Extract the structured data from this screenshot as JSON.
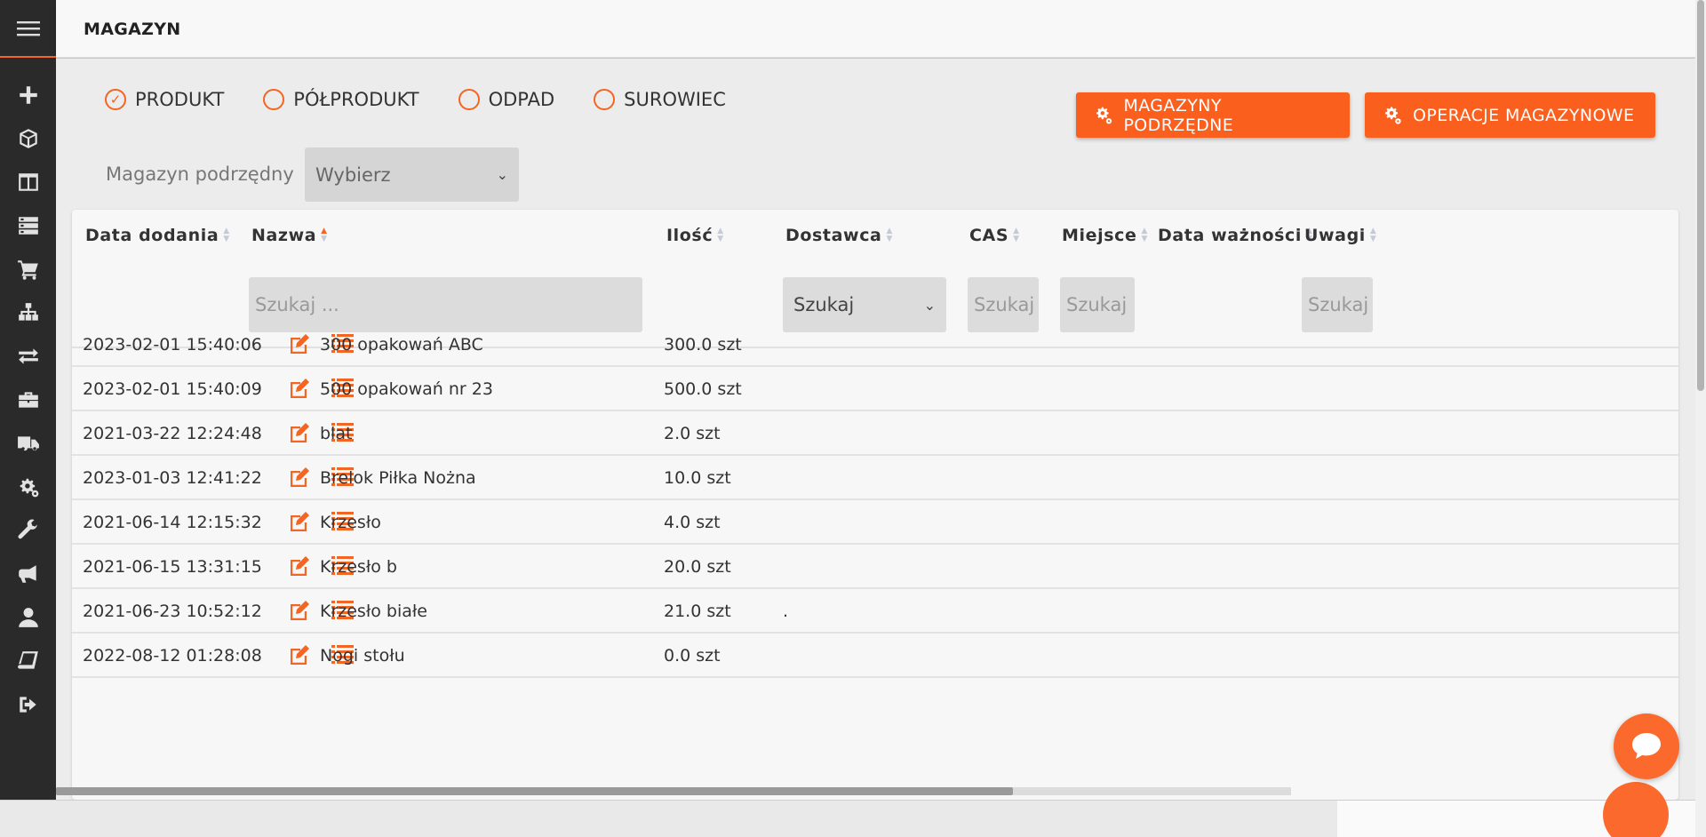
{
  "header": {
    "title": "MAGAZYN"
  },
  "filters": {
    "radios": [
      {
        "label": "PRODUKT",
        "checked": true
      },
      {
        "label": "PÓŁPRODUKT",
        "checked": false
      },
      {
        "label": "ODPAD",
        "checked": false
      },
      {
        "label": "SUROWIEC",
        "checked": false
      }
    ],
    "sub_label": "Magazyn podrzędny",
    "sub_select_value": "Wybierz"
  },
  "actions": {
    "sub_warehouses": "MAGAZYNY PODRZĘDNE",
    "operations": "OPERACJE MAGAZYNOWE"
  },
  "table": {
    "columns": [
      "Data dodania",
      "Nazwa",
      "Ilość",
      "Dostawca",
      "CAS",
      "Miejsce",
      "Data ważności",
      "Uwagi"
    ],
    "filters": {
      "name_placeholder": "Szukaj ...",
      "supplier_value": "Szukaj",
      "cas_placeholder": "Szukaj ..",
      "place_placeholder": "Szukaj ...",
      "notes_placeholder": "Szukaj .."
    },
    "rows": [
      {
        "date": "2023-02-01 15:40:06",
        "name": "300 opakowań ABC",
        "qty": "300.0 szt",
        "supplier": ""
      },
      {
        "date": "2023-02-01 15:40:09",
        "name": "500 opakowań nr 23",
        "qty": "500.0 szt",
        "supplier": ""
      },
      {
        "date": "2021-03-22 12:24:48",
        "name": "blat",
        "qty": "2.0 szt",
        "supplier": ""
      },
      {
        "date": "2023-01-03 12:41:22",
        "name": "Brelok Piłka Nożna",
        "qty": "10.0 szt",
        "supplier": ""
      },
      {
        "date": "2021-06-14 12:15:32",
        "name": "Krzesło",
        "qty": "4.0 szt",
        "supplier": ""
      },
      {
        "date": "2021-06-15 13:31:15",
        "name": "Krzesło b",
        "qty": "20.0 szt",
        "supplier": ""
      },
      {
        "date": "2021-06-23 10:52:12",
        "name": "Krzesło białe",
        "qty": "21.0 szt",
        "supplier": "."
      },
      {
        "date": "2022-08-12 01:28:08",
        "name": "Nogi stołu",
        "qty": "0.0 szt",
        "supplier": ""
      }
    ]
  },
  "colors": {
    "accent": "#f26522",
    "sidebar": "#2a2a2a"
  },
  "sidebar_icons": [
    "menu-icon",
    "plus-icon",
    "box-icon",
    "columns-icon",
    "list-icon",
    "cart-icon",
    "sitemap-icon",
    "exchange-icon",
    "briefcase-icon",
    "truck-icon",
    "gears-icon",
    "wrench-icon",
    "megaphone-icon",
    "user-icon",
    "book-icon",
    "logout-icon"
  ]
}
